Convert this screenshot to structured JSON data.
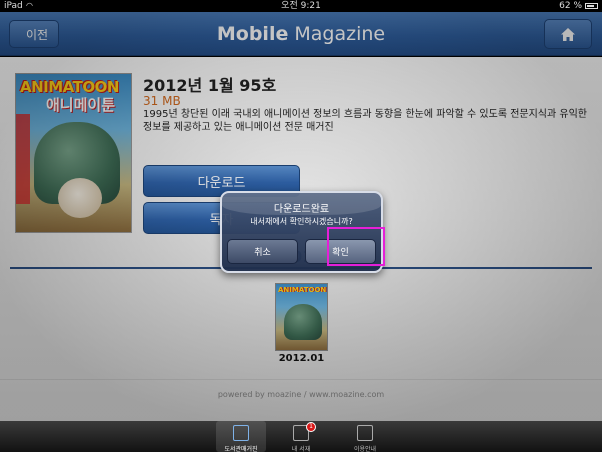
{
  "status_bar": {
    "carrier": "iPad",
    "time": "오전 9:21",
    "battery": "62 %"
  },
  "nav": {
    "back_label": "이전",
    "title_bold": "Mobile",
    "title_rest": " Magazine"
  },
  "issue": {
    "title": "2012년 1월 95호",
    "size": "31 MB",
    "description": "1995년 창단된 이래 국내외 애니메이션 정보의 흐름과 동향을 한눈에 파악할 수 있도록 전문지식과 유익한 정보를 제공하고 있는 애니메이션 전문 매거진",
    "cover_logo": "ANIMATOON",
    "cover_sub": "애니메이툰",
    "download_label": "다운로드",
    "read_label": "독자"
  },
  "year_label": "2012",
  "thumbnail": {
    "label": "2012.01",
    "logo": "ANIMATOON"
  },
  "footer": {
    "powered": "powered by moazine / www.moazine.com"
  },
  "alert": {
    "title": "다운로드완료",
    "message": "내서재에서 확인하시겠습니까?",
    "cancel": "취소",
    "ok": "확인"
  },
  "tabs": [
    {
      "label": "도서관매거진",
      "active": true
    },
    {
      "label": "내 서재",
      "badge": "1"
    },
    {
      "label": "이용안내"
    }
  ],
  "colors": {
    "nav_blue": "#2f5f9f",
    "file_size": "#d2691e",
    "highlight": "#e51fd8"
  }
}
